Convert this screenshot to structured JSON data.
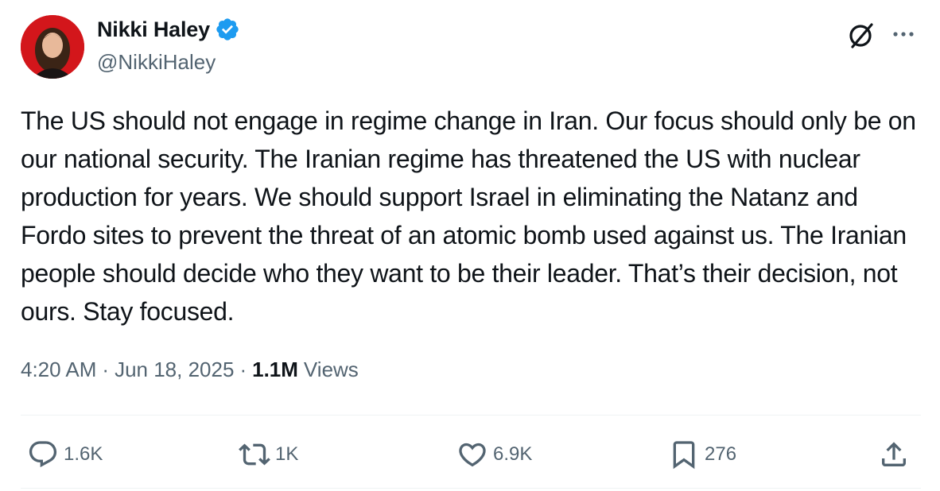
{
  "author": {
    "display_name": "Nikki Haley",
    "handle": "@NikkiHaley",
    "verified": true
  },
  "tweet": {
    "text": "The US should not engage in regime change in Iran. Our focus should only be on our national security. The Iranian regime has threatened the US with nuclear production for years. We should support Israel in eliminating the Natanz and Fordo sites to prevent the threat of an atomic bomb used against us. The Iranian people should decide who they want to be their leader. That’s their decision, not ours. Stay focused.",
    "time": "4:20 AM",
    "separator": "·",
    "date": "Jun 18, 2025",
    "views_count": "1.1M",
    "views_label": "Views"
  },
  "actions": {
    "replies": "1.6K",
    "reposts": "1K",
    "likes": "6.9K",
    "bookmarks": "276"
  },
  "icons": {
    "verified": "verified-badge-icon",
    "grok": "grok-icon",
    "more": "more-icon",
    "reply": "reply-icon",
    "repost": "repost-icon",
    "like": "heart-icon",
    "bookmark": "bookmark-icon",
    "share": "share-icon"
  },
  "colors": {
    "text": "#0f1419",
    "secondary": "#536471",
    "verified": "#1d9bf0",
    "divider": "#eff3f4"
  }
}
